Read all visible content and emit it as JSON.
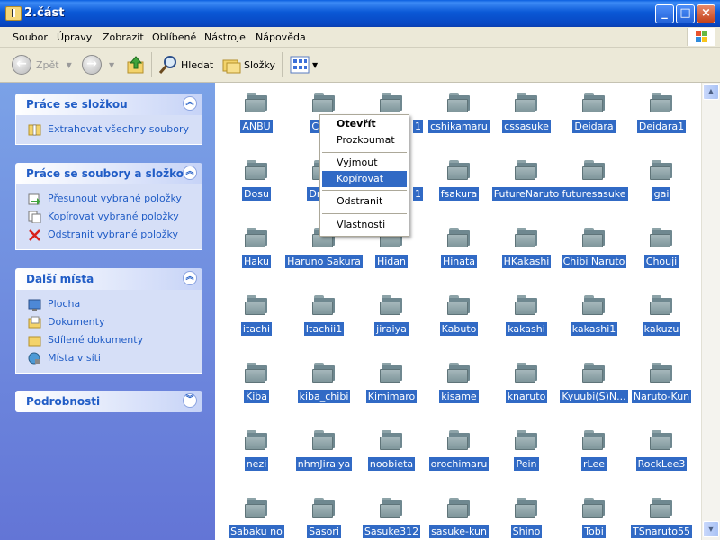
{
  "window": {
    "title": "2.část"
  },
  "menu": [
    "Soubor",
    "Úpravy",
    "Zobrazit",
    "Oblíbené",
    "Nástroje",
    "Nápověda"
  ],
  "toolbar": {
    "back": "Zpět",
    "search": "Hledat",
    "folders": "Složky"
  },
  "left_panel": {
    "sections": [
      {
        "title": "Práce se složkou",
        "items": [
          "Extrahovat všechny soubory"
        ]
      },
      {
        "title": "Práce se soubory a složkou",
        "items": [
          "Přesunout vybrané položky",
          "Kopírovat vybrané položky",
          "Odstranit vybrané položky"
        ]
      },
      {
        "title": "Další místa",
        "items": [
          "Plocha",
          "Dokumenty",
          "Sdílené dokumenty",
          "Místa v síti"
        ]
      },
      {
        "title": "Podrobnosti",
        "items": []
      }
    ]
  },
  "folders": [
    "ANBU",
    "CS2_",
    "",
    "cshikamaru",
    "cssasuke",
    "Deidara",
    "Deidara1",
    "Dosu",
    "Drunk",
    "",
    "fsakura",
    "FutureNaruto",
    "futuresasuke",
    "gai",
    "Haku",
    "Haruno Sakura",
    "Hidan",
    "Hinata",
    "HKakashi",
    "Chibi Naruto",
    "Chouji",
    "itachi",
    "Itachii1",
    "jiraiya",
    "Kabuto",
    "kakashi",
    "kakashi1",
    "kakuzu",
    "Kiba",
    "kiba_chibi",
    "Kimimaro",
    "kisame",
    "knaruto",
    "Kyuubi(S)N...",
    "Naruto-Kun",
    "nezi",
    "nhmJiraiya",
    "noobieta",
    "orochimaru",
    "Pein",
    "rLee",
    "RockLee3",
    "Sabaku no",
    "Sasori",
    "Sasuke312",
    "sasuke-kun",
    "Shino",
    "Tobi",
    "TSnaruto55"
  ],
  "folder_partial_labels": {
    "2": "1"
  },
  "context_menu": {
    "items": [
      "Otevřít",
      "Prozkoumat",
      "Vyjmout",
      "Kopírovat",
      "Odstranit",
      "Vlastnosti"
    ],
    "selected": "Kopírovat"
  },
  "colors": {
    "selection": "#316ac5",
    "task_link": "#215dc6"
  }
}
